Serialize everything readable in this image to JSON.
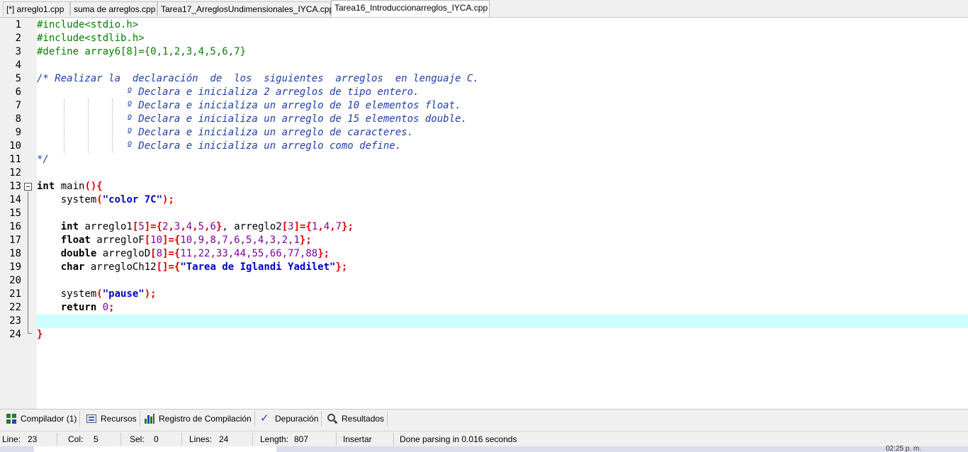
{
  "tabs": [
    {
      "label": "[*] arreglo1.cpp"
    },
    {
      "label": "suma de arreglos.cpp"
    },
    {
      "label": "Tarea17_ArreglosUndimensionales_IYCA.cpp"
    },
    {
      "label": "Tarea16_Introduccionarreglos_IYCA.cpp"
    }
  ],
  "editor": {
    "line_numbers": [
      "1",
      "2",
      "3",
      "4",
      "5",
      "6",
      "7",
      "8",
      "9",
      "10",
      "11",
      "12",
      "13",
      "14",
      "15",
      "16",
      "17",
      "18",
      "19",
      "20",
      "21",
      "22",
      "23",
      "24"
    ],
    "l1": "#include<stdio.h>",
    "l2": "#include<stdlib.h>",
    "l3": "#define array6[8]={0,1,2,3,4,5,6,7}",
    "l5": "/* Realizar la  declaración  de  los  siguientes  arreglos  en lenguaje C.",
    "l6": "               º Declara e inicializa 2 arreglos de tipo entero.",
    "l7": "               º Declara e inicializa un arreglo de 10 elementos float.",
    "l8": "               º Declara e inicializa un arreglo de 15 elementos double.",
    "l9": "               º Declara e inicializa un arreglo de caracteres.",
    "l10": "               º Declara e inicializa un arreglo como define.",
    "l11": "*/",
    "l13": {
      "kw": "int",
      "a": " main",
      "b": "(){"
    },
    "l14": {
      "a": "    system",
      "b": "(",
      "c": "\"color 7C\"",
      "d": ");"
    },
    "l16": {
      "kw": "    int",
      "a": " arreglo1",
      "b": "[",
      "n1": "5",
      "c": "]={",
      "n2": "2",
      "d": ",",
      "n3": "3",
      "e": ",",
      "n4": "4",
      "f": ",",
      "n5": "5",
      "g": ",",
      "n6": "6",
      "h": "}",
      "i": ", arreglo2",
      "j": "[",
      "n7": "3",
      "k": "]={",
      "n8": "1",
      "l": ",",
      "n9": "4",
      "m": ",",
      "n10": "7",
      "o": "};"
    },
    "l17": {
      "kw": "    float",
      "a": " arregloF",
      "b": "[",
      "n1": "10",
      "c": "]={",
      "nums": "10,9,8,7,6,5,4,3,2,1",
      "d": "};"
    },
    "l18": {
      "kw": "    double",
      "a": " arregloD",
      "b": "[",
      "n1": "8",
      "c": "]={",
      "nums": "11,22,33,44,55,66,77,88",
      "d": "};"
    },
    "l19": {
      "kw": "    char",
      "a": " arregloCh12",
      "b": "[]={",
      "c": "\"Tarea de Iglandi Yadilet\"",
      "d": "};"
    },
    "l21": {
      "a": "    system",
      "b": "(",
      "c": "\"pause\"",
      "d": ");"
    },
    "l22": {
      "kw": "    return",
      "a": " ",
      "n": "0",
      "b": ";"
    },
    "l24": "}"
  },
  "bottom_tabs": [
    {
      "label": "Compilador (1)"
    },
    {
      "label": "Recursos"
    },
    {
      "label": "Registro de Compilación"
    },
    {
      "label": "Depuración"
    },
    {
      "label": "Resultados"
    }
  ],
  "status": {
    "line_label": "Line:",
    "line_value": "23",
    "col_label": "Col:",
    "col_value": "5",
    "sel_label": "Sel:",
    "sel_value": "0",
    "lines_label": "Lines:",
    "lines_value": "24",
    "length_label": "Length:",
    "length_value": "807",
    "mode": "Insertar",
    "message": "Done parsing in 0.016 seconds"
  },
  "taskbar": {
    "clock": "02:25 p. m."
  }
}
